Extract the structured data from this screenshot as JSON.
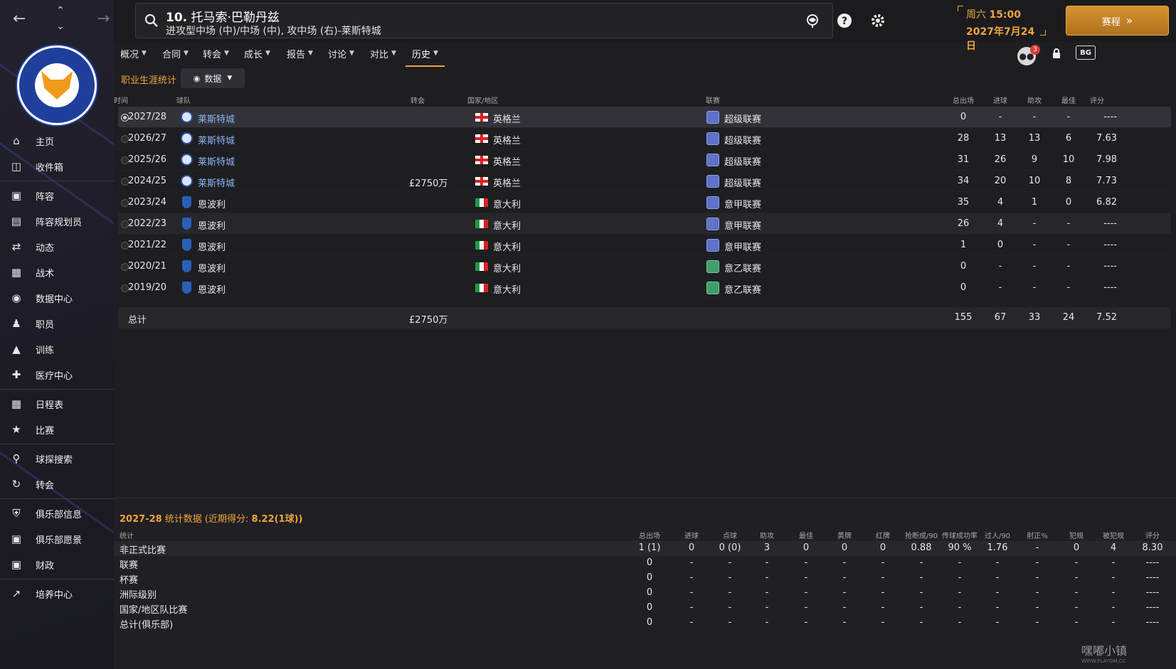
{
  "header": {
    "player_number": "10.",
    "player_name": "托马索·巴勒丹兹",
    "player_positions": "进攻型中场 (中)/中场 (中), 攻中场 (右)-莱斯特城",
    "date_line1_prefix": "周六 ",
    "date_line1_time": "15:00",
    "date_line2": "2027年7月24日",
    "continue_label": "赛程"
  },
  "tabs": [
    {
      "label": "概况"
    },
    {
      "label": "合同"
    },
    {
      "label": "转会"
    },
    {
      "label": "成长"
    },
    {
      "label": "报告"
    },
    {
      "label": "讨论"
    },
    {
      "label": "对比"
    },
    {
      "label": "历史"
    }
  ],
  "active_tab": "历史",
  "notifications_count": "3",
  "sidebar": {
    "items": [
      {
        "label": "主页",
        "icon": "home-icon"
      },
      {
        "label": "收件箱",
        "icon": "inbox-icon"
      },
      {
        "label": "阵容",
        "icon": "shirt-icon"
      },
      {
        "label": "阵容规划员",
        "icon": "clipboard-icon"
      },
      {
        "label": "动态",
        "icon": "dynamics-icon"
      },
      {
        "label": "战术",
        "icon": "tactics-icon"
      },
      {
        "label": "数据中心",
        "icon": "data-hub-icon"
      },
      {
        "label": "职员",
        "icon": "staff-icon"
      },
      {
        "label": "训练",
        "icon": "training-icon"
      },
      {
        "label": "医疗中心",
        "icon": "medical-icon"
      },
      {
        "label": "日程表",
        "icon": "calendar-icon"
      },
      {
        "label": "比赛",
        "icon": "trophy-icon"
      },
      {
        "label": "球探搜索",
        "icon": "scout-search-icon"
      },
      {
        "label": "转会",
        "icon": "transfer-icon"
      },
      {
        "label": "俱乐部信息",
        "icon": "shield-icon"
      },
      {
        "label": "俱乐部愿景",
        "icon": "briefcase-icon"
      },
      {
        "label": "财政",
        "icon": "finance-icon"
      },
      {
        "label": "培养中心",
        "icon": "development-icon"
      }
    ]
  },
  "subbar": {
    "title": "职业生涯统计",
    "view_dropdown": "数据"
  },
  "career": {
    "columns": [
      "时间",
      "球队",
      "转会",
      "国家/地区",
      "联赛",
      "总出场",
      "进球",
      "助攻",
      "最佳",
      "评分"
    ],
    "rows": [
      {
        "season": "2027/28",
        "club": "莱斯特城",
        "fee": "",
        "nation": "英格兰",
        "league": "超级联赛",
        "apps": "0",
        "goals": "-",
        "assists": "-",
        "pom": "-",
        "rating": "----"
      },
      {
        "season": "2026/27",
        "club": "莱斯特城",
        "fee": "",
        "nation": "英格兰",
        "league": "超级联赛",
        "apps": "28",
        "goals": "13",
        "assists": "13",
        "pom": "6",
        "rating": "7.63"
      },
      {
        "season": "2025/26",
        "club": "莱斯特城",
        "fee": "",
        "nation": "英格兰",
        "league": "超级联赛",
        "apps": "31",
        "goals": "26",
        "assists": "9",
        "pom": "10",
        "rating": "7.98"
      },
      {
        "season": "2024/25",
        "club": "莱斯特城",
        "fee": "£2750万",
        "nation": "英格兰",
        "league": "超级联赛",
        "apps": "34",
        "goals": "20",
        "assists": "10",
        "pom": "8",
        "rating": "7.73"
      },
      {
        "season": "2023/24",
        "club": "恩波利",
        "fee": "",
        "nation": "意大利",
        "league": "意甲联赛",
        "apps": "35",
        "goals": "4",
        "assists": "1",
        "pom": "0",
        "rating": "6.82"
      },
      {
        "season": "2022/23",
        "club": "恩波利",
        "fee": "",
        "nation": "意大利",
        "league": "意甲联赛",
        "apps": "26",
        "goals": "4",
        "assists": "-",
        "pom": "-",
        "rating": "----"
      },
      {
        "season": "2021/22",
        "club": "恩波利",
        "fee": "",
        "nation": "意大利",
        "league": "意甲联赛",
        "apps": "1",
        "goals": "0",
        "assists": "-",
        "pom": "-",
        "rating": "----"
      },
      {
        "season": "2020/21",
        "club": "恩波利",
        "fee": "",
        "nation": "意大利",
        "league": "意乙联赛",
        "apps": "0",
        "goals": "-",
        "assists": "-",
        "pom": "-",
        "rating": "----"
      },
      {
        "season": "2019/20",
        "club": "恩波利",
        "fee": "",
        "nation": "意大利",
        "league": "意乙联赛",
        "apps": "0",
        "goals": "-",
        "assists": "-",
        "pom": "-",
        "rating": "----"
      }
    ],
    "total": {
      "label": "总计",
      "fee": "£2750万",
      "apps": "155",
      "goals": "67",
      "assists": "33",
      "pom": "24",
      "rating": "7.52"
    }
  },
  "season_stats": {
    "title_year": "2027-28",
    "title_text": " 统计数据 (近期得分: ",
    "title_form": "8.22(1球)",
    "title_close": ")",
    "columns": [
      "统计",
      "总出场",
      "进球",
      "点球",
      "助攻",
      "最佳",
      "黄牌",
      "红牌",
      "抢断成/90",
      "传球成功率",
      "过人/90",
      "射正%",
      "犯规",
      "被犯规",
      "评分"
    ],
    "rows": [
      {
        "label": "非正式比赛",
        "values": [
          "1 (1)",
          "0",
          "0 (0)",
          "3",
          "0",
          "0",
          "0",
          "0.88",
          "90 %",
          "1.76",
          "-",
          "0",
          "4",
          "8.30"
        ]
      },
      {
        "label": "联赛",
        "values": [
          "0",
          "-",
          "-",
          "-",
          "-",
          "-",
          "-",
          "-",
          "-",
          "-",
          "-",
          "-",
          "-",
          "----"
        ]
      },
      {
        "label": "杯赛",
        "values": [
          "0",
          "-",
          "-",
          "-",
          "-",
          "-",
          "-",
          "-",
          "-",
          "-",
          "-",
          "-",
          "-",
          "----"
        ]
      },
      {
        "label": "洲际级别",
        "values": [
          "0",
          "-",
          "-",
          "-",
          "-",
          "-",
          "-",
          "-",
          "-",
          "-",
          "-",
          "-",
          "-",
          "----"
        ]
      },
      {
        "label": "国家/地区队比赛",
        "values": [
          "0",
          "-",
          "-",
          "-",
          "-",
          "-",
          "-",
          "-",
          "-",
          "-",
          "-",
          "-",
          "-",
          "----"
        ]
      },
      {
        "label": "总计(俱乐部)",
        "values": [
          "0",
          "-",
          "-",
          "-",
          "-",
          "-",
          "-",
          "-",
          "-",
          "-",
          "-",
          "-",
          "-",
          "----"
        ]
      }
    ]
  },
  "watermark": {
    "text": "嘿嘟小镇",
    "url": "WWW.PLAYGM.CC"
  },
  "colors": {
    "accent": "#f0a43a",
    "link": "#8db2f0",
    "brand_blue": "#1f3f9c"
  }
}
